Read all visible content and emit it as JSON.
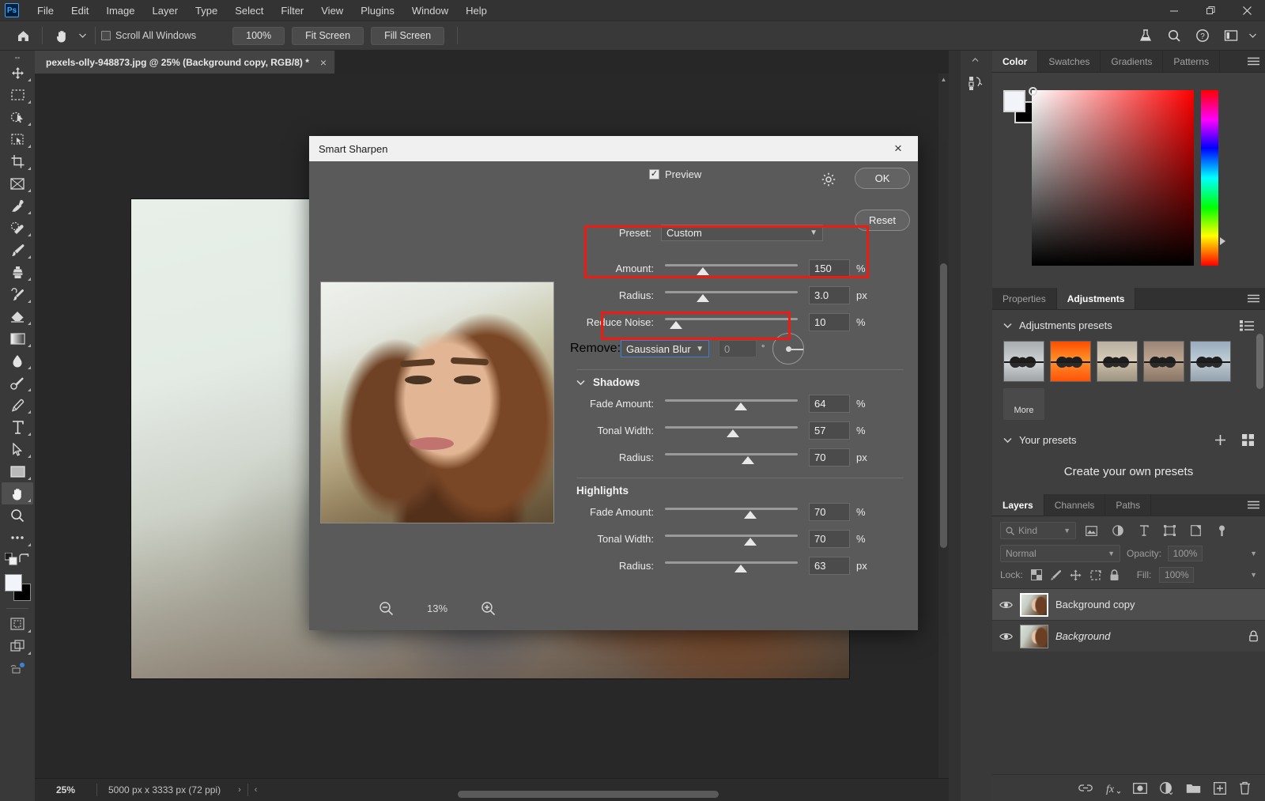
{
  "app": {
    "logo": "Ps",
    "menus": [
      "File",
      "Edit",
      "Image",
      "Layer",
      "Type",
      "Select",
      "Filter",
      "View",
      "Plugins",
      "Window",
      "Help"
    ],
    "window_controls": [
      "minimize",
      "restore",
      "close"
    ]
  },
  "options_bar": {
    "home_icon": "home-icon",
    "tool_icon": "hand-tool-icon",
    "scroll_all_label": "Scroll All Windows",
    "buttons": [
      "100%",
      "Fit Screen",
      "Fill Screen"
    ],
    "right_icons": [
      "flask-icon",
      "search-icon",
      "help-icon",
      "workspace-icon"
    ]
  },
  "document": {
    "tab_title": "pexels-olly-948873.jpg @ 25% (Background copy, RGB/8) *",
    "close_glyph": "×"
  },
  "status_bar": {
    "zoom": "25%",
    "doc_info": "5000 px x 3333 px (72 ppi)",
    "chevron_right": "›",
    "chevron_left": "‹"
  },
  "toolbar": {
    "tools": [
      {
        "name": "move-tool"
      },
      {
        "name": "rectangular-marquee-tool"
      },
      {
        "name": "object-selection-tool"
      },
      {
        "name": "lasso-tool"
      },
      {
        "name": "crop-tool"
      },
      {
        "name": "frame-tool"
      },
      {
        "name": "eyedropper-tool"
      },
      {
        "name": "spot-healing-brush-tool"
      },
      {
        "name": "brush-tool"
      },
      {
        "name": "clone-stamp-tool"
      },
      {
        "name": "history-brush-tool"
      },
      {
        "name": "eraser-tool"
      },
      {
        "name": "gradient-tool"
      },
      {
        "name": "blur-tool"
      },
      {
        "name": "dodge-tool"
      },
      {
        "name": "pen-tool"
      },
      {
        "name": "type-tool"
      },
      {
        "name": "path-selection-tool"
      },
      {
        "name": "rectangle-tool"
      },
      {
        "name": "hand-tool"
      },
      {
        "name": "zoom-tool"
      },
      {
        "name": "edit-toolbar-tool"
      }
    ],
    "foreground_color": "#f2f4fa",
    "background_color": "#000000"
  },
  "dialog": {
    "title": "Smart Sharpen",
    "close_glyph": "×",
    "preview_label": "Preview",
    "preview_checked": true,
    "gear_icon": "gear-icon",
    "ok_label": "OK",
    "reset_label": "Reset",
    "preset_label": "Preset:",
    "preset_value": "Custom",
    "sharpen_controls": [
      {
        "label": "Amount:",
        "value": "150",
        "unit": "%",
        "knob_pct": 28,
        "highlighted": true
      },
      {
        "label": "Radius:",
        "value": "3.0",
        "unit": "px",
        "knob_pct": 28,
        "highlighted": true
      },
      {
        "label": "Reduce Noise:",
        "value": "10",
        "unit": "%",
        "knob_pct": 7,
        "highlighted": false
      }
    ],
    "remove": {
      "label": "Remove:",
      "value": "Gaussian Blur",
      "angle": "0",
      "degree_glyph": "°",
      "highlighted": true
    },
    "shadows": {
      "title": "Shadows",
      "collapsed": false,
      "controls": [
        {
          "label": "Fade Amount:",
          "value": "64",
          "unit": "%",
          "knob_pct": 57
        },
        {
          "label": "Tonal Width:",
          "value": "57",
          "unit": "%",
          "knob_pct": 51
        },
        {
          "label": "Radius:",
          "value": "70",
          "unit": "px",
          "knob_pct": 62
        }
      ]
    },
    "highlights": {
      "title": "Highlights",
      "controls": [
        {
          "label": "Fade Amount:",
          "value": "70",
          "unit": "%",
          "knob_pct": 63
        },
        {
          "label": "Tonal Width:",
          "value": "70",
          "unit": "%",
          "knob_pct": 63
        },
        {
          "label": "Radius:",
          "value": "63",
          "unit": "px",
          "knob_pct": 57
        }
      ]
    },
    "zoom_out_icon": "zoom-out-icon",
    "zoom_level": "13%",
    "zoom_in_icon": "zoom-in-icon",
    "highlight_color": "#f01a12"
  },
  "right_dock": {
    "color_group": {
      "tabs": [
        "Color",
        "Swatches",
        "Gradients",
        "Patterns"
      ],
      "selected": "Color",
      "menu_icon": "panel-menu-icon"
    },
    "adjustments_group": {
      "tabs": [
        "Properties",
        "Adjustments"
      ],
      "selected": "Adjustments",
      "menu_icon": "panel-menu-icon",
      "presets_section_title": "Adjustments presets",
      "list-view-icon": "list-view-icon",
      "preset_thumbs": [
        {
          "name": "preset-bw",
          "sky": "#b9bcbd",
          "water": "#cfd2d3"
        },
        {
          "name": "preset-sunset",
          "sky": "#ff6a1a",
          "water": "#ff8c2a"
        },
        {
          "name": "preset-warm",
          "sky": "#c2b09a",
          "water": "#b9ae9d"
        },
        {
          "name": "preset-sepia",
          "sky": "#a08878",
          "water": "#9c8878"
        },
        {
          "name": "preset-cool",
          "sky": "#a6b6c4",
          "water": "#b6c3cd"
        }
      ],
      "more_label": "More",
      "your_presets_title": "Your presets",
      "add_icon": "plus-icon",
      "grid_icon": "grid-view-icon",
      "empty_text": "Create your own presets"
    },
    "layers_group": {
      "tabs": [
        "Layers",
        "Channels",
        "Paths"
      ],
      "selected": "Layers",
      "menu_icon": "panel-menu-icon",
      "filter_placeholder": "Kind",
      "filter_icons": [
        "pixel-filter-icon",
        "adjustment-filter-icon",
        "type-filter-icon",
        "shape-filter-icon",
        "smart-object-filter-icon",
        "filter-toggle-icon"
      ],
      "blend_mode": "Normal",
      "opacity_label": "Opacity:",
      "opacity_value": "100%",
      "lock_label": "Lock:",
      "lock_icons": [
        "lock-transparency-icon",
        "lock-image-icon",
        "lock-position-icon",
        "lock-artboard-icon",
        "lock-all-icon"
      ],
      "fill_label": "Fill:",
      "fill_value": "100%",
      "layers": [
        {
          "name": "Background copy",
          "visible": true,
          "selected": true,
          "locked": false,
          "italic": false
        },
        {
          "name": "Background",
          "visible": true,
          "selected": false,
          "locked": true,
          "italic": true
        }
      ],
      "bottom_icons": [
        "link-layers-icon",
        "layer-style-icon",
        "layer-mask-icon",
        "new-adjustment-layer-icon",
        "new-group-icon",
        "new-layer-icon",
        "delete-layer-icon"
      ]
    }
  }
}
